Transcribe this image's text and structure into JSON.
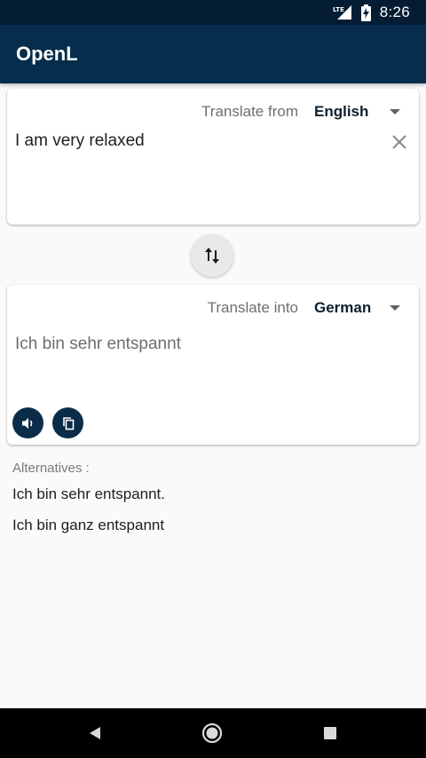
{
  "status_bar": {
    "time": "8:26",
    "network": "LTE",
    "icons": [
      "lte-signal-icon",
      "battery-charging-icon"
    ]
  },
  "app_bar": {
    "title": "OpenL"
  },
  "source_card": {
    "caption": "Translate from",
    "language": "English",
    "text": "I am very relaxed",
    "icons": [
      "dropdown-arrow-icon",
      "clear-icon"
    ]
  },
  "swap": {
    "icon": "swap-vertical-icon"
  },
  "target_card": {
    "caption": "Translate into",
    "language": "German",
    "text": "Ich bin sehr entspannt",
    "icons": [
      "dropdown-arrow-icon",
      "speaker-icon",
      "copy-icon"
    ]
  },
  "alternatives": {
    "label": "Alternatives :",
    "items": [
      "Ich bin sehr entspannt.",
      "Ich bin ganz entspannt"
    ]
  },
  "nav_bar": {
    "icons": [
      "back-icon",
      "home-icon",
      "recents-icon"
    ]
  },
  "colors": {
    "status_bar": "#041d33",
    "app_bar": "#062d4b",
    "action_button": "#0a2c49",
    "background": "#fafafa"
  }
}
